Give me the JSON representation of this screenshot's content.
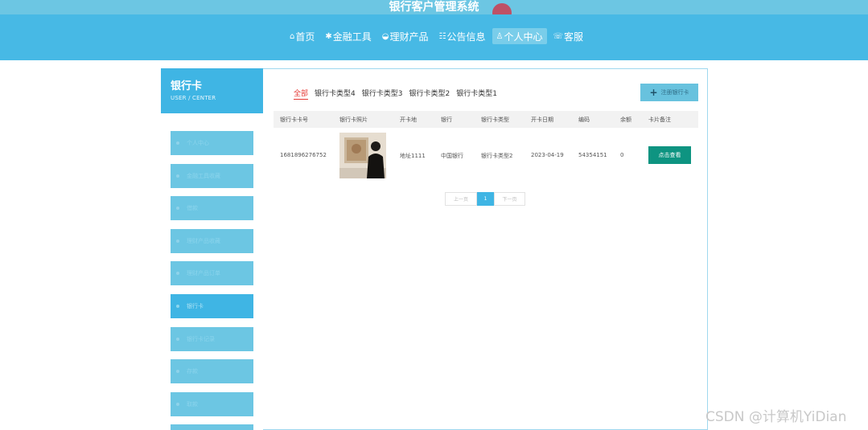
{
  "header": {
    "site_title": "银行客户管理系统",
    "nav": [
      {
        "icon": "⌂",
        "label": "首页"
      },
      {
        "icon": "✱",
        "label": "金融工具"
      },
      {
        "icon": "◒",
        "label": "理财产品"
      },
      {
        "icon": "☷",
        "label": "公告信息"
      },
      {
        "icon": "♙",
        "label": "个人中心"
      },
      {
        "icon": "☏",
        "label": "客服"
      }
    ]
  },
  "sidebar": {
    "title": "银行卡",
    "subtitle": "USER / CENTER",
    "items": [
      "个人中心",
      "金融工具收藏",
      "借款",
      "理财产品收藏",
      "理财产品订单",
      "银行卡",
      "银行卡记录",
      "存款",
      "取款"
    ]
  },
  "main": {
    "tabs": [
      "全部",
      "银行卡类型4",
      "银行卡类型3",
      "银行卡类型2",
      "银行卡类型1"
    ],
    "register_button": "注册银行卡",
    "columns": [
      "银行卡卡号",
      "银行卡照片",
      "开卡地",
      "银行",
      "银行卡类型",
      "开卡日期",
      "编码",
      "余额",
      "卡片备注"
    ],
    "rows": [
      {
        "card_no": "1681896276752",
        "address": "地址1111",
        "bank": "中国银行",
        "type": "银行卡类型2",
        "date": "2023-04-19",
        "code": "54354151",
        "balance": "0",
        "action": "点击查看"
      }
    ],
    "pager": {
      "prev": "上一页",
      "current": "1",
      "next": "下一页"
    }
  },
  "watermark": "CSDN @计算机YiDian",
  "colors": {
    "header": "#47b9e5",
    "topbar": "#6cc6e3",
    "sidebar_active": "#3fb5e4",
    "action_button": "#0e9481",
    "tab_active": "#e53935"
  }
}
